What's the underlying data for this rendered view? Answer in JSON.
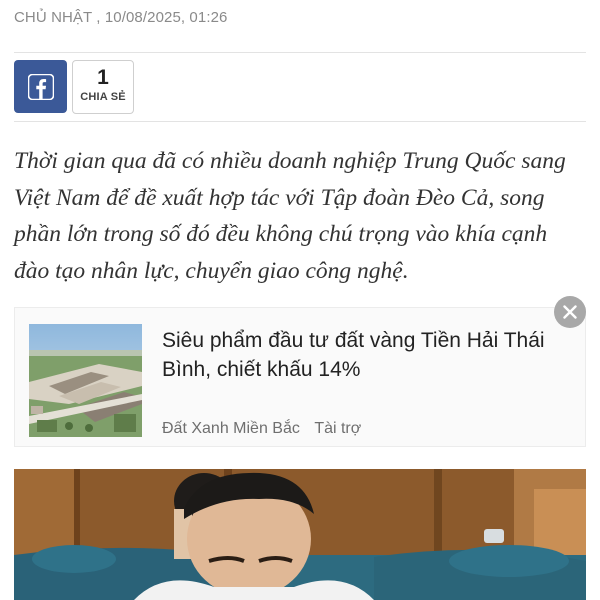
{
  "article": {
    "dateline": "CHỦ NHẬT , 10/08/2025, 01:26",
    "sapo": "Thời gian qua đã có nhiều doanh nghiệp Trung Quốc sang Việt Nam để đề xuất hợp tác với Tập đoàn Đèo Cả, song phần lớn trong số đó đều không chú trọng vào khía cạnh đào tạo nhân lực, chuyển giao công nghệ."
  },
  "share": {
    "network_icon": "facebook-icon",
    "count": "1",
    "label": "CHIA SẺ"
  },
  "sponsored": {
    "title": "Siêu phẩm đầu tư đất vàng Tiền Hải Thái Bình, chiết khấu 14%",
    "advertiser": "Đất Xanh Miền Bắc",
    "tag": "Tài trợ",
    "close_icon": "close-icon"
  },
  "colors": {
    "facebook": "#3b5998",
    "text_primary": "#222222",
    "text_muted": "#8a8a8a",
    "close_bg": "#a8a8a8"
  }
}
